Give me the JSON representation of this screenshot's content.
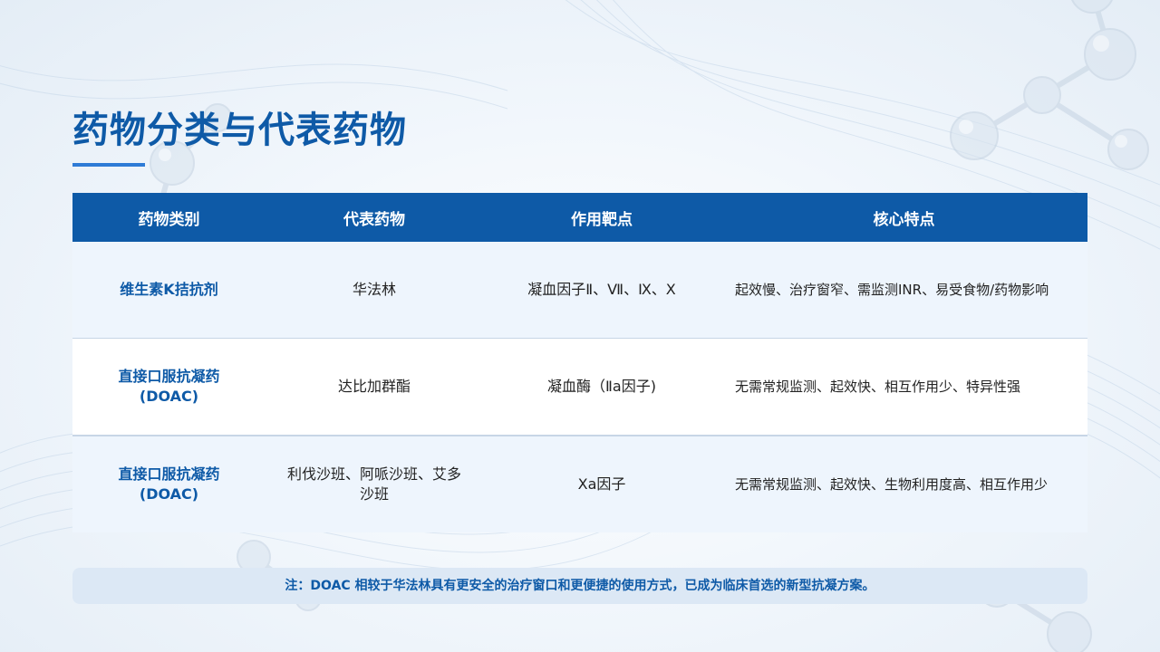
{
  "title": "药物分类与代表药物",
  "table": {
    "headers": [
      "药物类别",
      "代表药物",
      "作用靶点",
      "核心特点"
    ],
    "rows": [
      {
        "category": "维生素K拮抗剂",
        "drug": "华法林",
        "target": "凝血因子Ⅱ、Ⅶ、Ⅸ、Ⅹ",
        "features": "起效慢、治疗窗窄、需监测INR、易受食物/药物影响"
      },
      {
        "category": "直接口服抗凝药(DOAC)",
        "drug": "达比加群酯",
        "target": "凝血酶（Ⅱa因子)",
        "features": "无需常规监测、起效快、相互作用少、特异性强"
      },
      {
        "category": "直接口服抗凝药(DOAC)",
        "drug": "利伐沙班、阿哌沙班、艾多沙班",
        "target": "Xa因子",
        "features": "无需常规监测、起效快、生物利用度高、相互作用少"
      }
    ]
  },
  "note": "注：DOAC 相较于华法林具有更安全的治疗窗口和更便捷的使用方式，已成为临床首选的新型抗凝方案。",
  "colors": {
    "accent": "#0e5aa7",
    "underline": "#2e7bd6",
    "row_tint": "#eef5fd",
    "note_bg": "#dce8f5"
  },
  "icons": [
    "molecule-decoration-icon",
    "wave-mesh-decoration"
  ]
}
